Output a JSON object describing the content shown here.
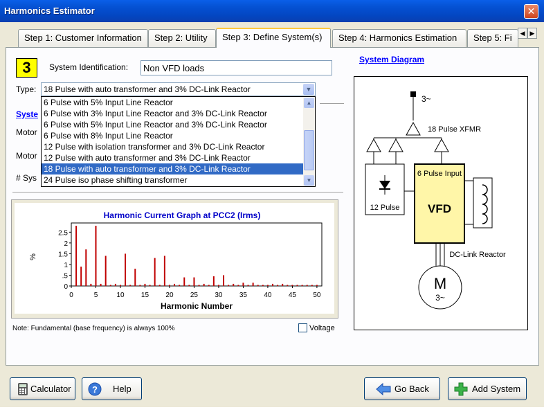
{
  "window": {
    "title": "Harmonics Estimator",
    "close_glyph": "✕"
  },
  "tabs": [
    {
      "label": "Step 1: Customer Information"
    },
    {
      "label": "Step 2: Utility"
    },
    {
      "label": "Step 3: Define System(s)"
    },
    {
      "label": "Step 4: Harmonics Estimation"
    },
    {
      "label": "Step 5: Fi"
    }
  ],
  "step_badge": "3",
  "system_id": {
    "label": "System Identification:",
    "value": "Non VFD loads"
  },
  "type": {
    "label": "Type:",
    "value": "18 Pulse with auto transformer and 3% DC-Link Reactor",
    "options": [
      "6 Pulse with 5% Input Line Reactor",
      "6 Pulse with 3% Input Line Reactor and 3% DC-Link Reactor",
      "6 Pulse with 5% Input Line Reactor and 3% DC-Link Reactor",
      "6 Pulse with 8% Input Line Reactor",
      "12 Pulse with isolation transformer and 3% DC-Link Reactor",
      "12 Pulse with auto transformer and 3% DC-Link Reactor",
      "18 Pulse with auto transformer and 3% DC-Link Reactor",
      "24 Pulse iso phase shifting transformer"
    ],
    "selected_index": 6
  },
  "partial_labels": {
    "system_link": "Syste",
    "motor1": "Motor",
    "motor2": "Motor",
    "num_sys": "# Sys"
  },
  "system_diagram_link": "System Diagram",
  "diagram": {
    "phase_label": "3~",
    "xfmr_label": "18 Pulse XFMR",
    "pulse12_label": "12 Pulse",
    "vfd_input_label": "6 Pulse Input",
    "vfd_label": "VFD",
    "dclink_label": "DC-Link Reactor",
    "motor_label": "M",
    "motor_phase": "3~"
  },
  "note": "Note: Fundamental (base frequency) is always 100%",
  "voltage_checkbox": {
    "label": "Voltage",
    "checked": false
  },
  "buttons": {
    "calculator": "Calculator",
    "help": "Help",
    "go_back": "Go Back",
    "add_system": "Add System"
  },
  "chart_data": {
    "type": "bar",
    "title": "Harmonic Current Graph at PCC2 (Irms)",
    "xlabel": "Harmonic Number",
    "ylabel": "%",
    "xlim": [
      0,
      51
    ],
    "ylim": [
      0,
      2.8
    ],
    "xticks": [
      0,
      5,
      10,
      15,
      20,
      25,
      30,
      35,
      40,
      45,
      50
    ],
    "yticks": [
      0,
      0.5,
      1,
      1.5,
      2,
      2.5
    ],
    "ytick_labels": [
      "0",
      ".5",
      "1",
      "1.5",
      "2",
      "2.5"
    ],
    "bar_color": "#c00000",
    "x": [
      1,
      2,
      3,
      4,
      5,
      6,
      7,
      8,
      9,
      10,
      11,
      12,
      13,
      14,
      15,
      16,
      17,
      18,
      19,
      20,
      21,
      22,
      23,
      24,
      25,
      26,
      27,
      28,
      29,
      30,
      31,
      32,
      33,
      34,
      35,
      36,
      37,
      38,
      39,
      40,
      41,
      42,
      43,
      44,
      45,
      46,
      47,
      48,
      49,
      50
    ],
    "values": [
      3.0,
      0.9,
      1.7,
      0.1,
      2.9,
      0.1,
      1.4,
      0.05,
      0.1,
      0.05,
      1.5,
      0.05,
      0.8,
      0.05,
      0.1,
      0.05,
      1.3,
      0.05,
      1.4,
      0.05,
      0.1,
      0.05,
      0.4,
      0.05,
      0.4,
      0.05,
      0.1,
      0.05,
      0.45,
      0.05,
      0.5,
      0.05,
      0.1,
      0.05,
      0.15,
      0.05,
      0.15,
      0.05,
      0.05,
      0.05,
      0.1,
      0.05,
      0.1,
      0.05,
      0.05,
      0.05,
      0.05,
      0.05,
      0.05,
      0.05
    ]
  }
}
